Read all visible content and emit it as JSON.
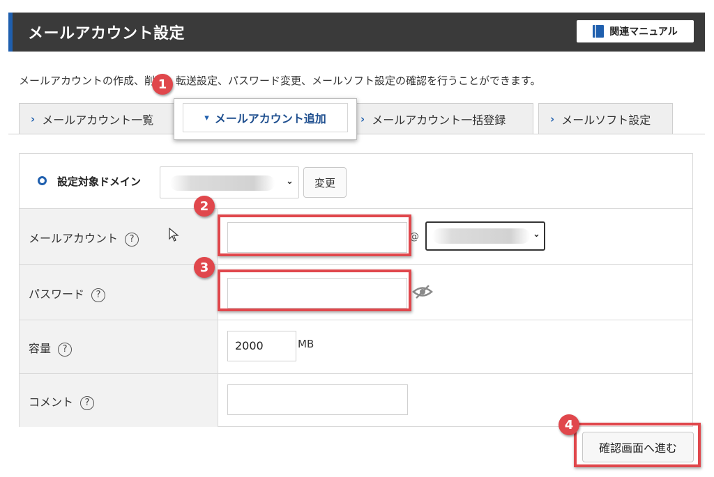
{
  "header": {
    "title": "メールアカウント設定",
    "manual_label": "関連マニュアル",
    "accent_color": "#1f5fae"
  },
  "description": "メールアカウントの作成、削除、転送設定、パスワード変更、メールソフト設定の確認を行うことができます。",
  "tabs": [
    {
      "label": "メールアカウント一覧",
      "active": false
    },
    {
      "label": "メールアカウント追加",
      "active": true
    },
    {
      "label": "メールアカウント一括登録",
      "active": false
    },
    {
      "label": "メールソフト設定",
      "active": false
    }
  ],
  "domain": {
    "label": "設定対象ドメイン",
    "change_label": "変更"
  },
  "form": {
    "account_label": "メールアカウント",
    "at_sign": "@",
    "password_label": "パスワード",
    "capacity_label": "容量",
    "capacity_value": "2000",
    "capacity_unit": "MB",
    "comment_label": "コメント",
    "help_glyph": "?"
  },
  "submit_label": "確認画面へ進む",
  "markers": [
    "1",
    "2",
    "3",
    "4"
  ],
  "highlight_color": "#e0474c"
}
